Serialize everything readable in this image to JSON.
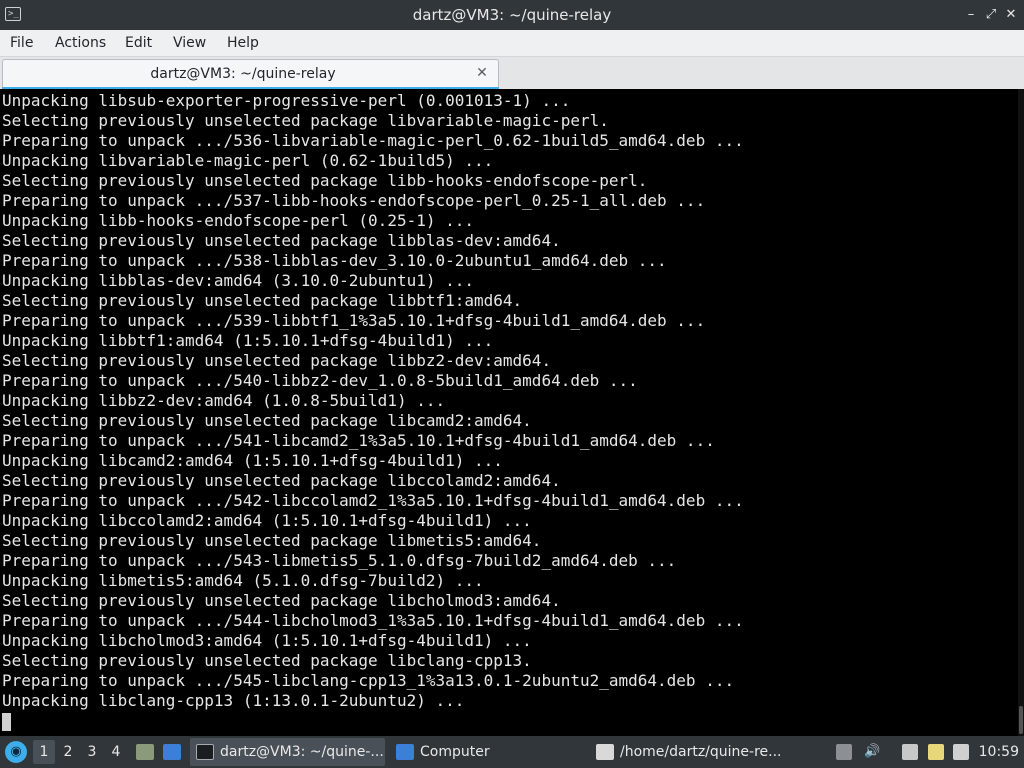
{
  "window": {
    "title": "dartz@VM3: ~/quine-relay",
    "app_icon_glyph": ">_",
    "min_glyph": "–",
    "max_glyph": "⤢",
    "close_glyph": "✕"
  },
  "menu": {
    "file": "File",
    "actions": "Actions",
    "edit": "Edit",
    "view": "View",
    "help": "Help"
  },
  "tab": {
    "label": "dartz@VM3: ~/quine-relay",
    "close_glyph": "✕",
    "accent_color": "#3daee9"
  },
  "terminal": {
    "background": "#000000",
    "foreground": "#e6e6e6",
    "lines": [
      "Unpacking libsub-exporter-progressive-perl (0.001013-1) ...",
      "Selecting previously unselected package libvariable-magic-perl.",
      "Preparing to unpack .../536-libvariable-magic-perl_0.62-1build5_amd64.deb ...",
      "Unpacking libvariable-magic-perl (0.62-1build5) ...",
      "Selecting previously unselected package libb-hooks-endofscope-perl.",
      "Preparing to unpack .../537-libb-hooks-endofscope-perl_0.25-1_all.deb ...",
      "Unpacking libb-hooks-endofscope-perl (0.25-1) ...",
      "Selecting previously unselected package libblas-dev:amd64.",
      "Preparing to unpack .../538-libblas-dev_3.10.0-2ubuntu1_amd64.deb ...",
      "Unpacking libblas-dev:amd64 (3.10.0-2ubuntu1) ...",
      "Selecting previously unselected package libbtf1:amd64.",
      "Preparing to unpack .../539-libbtf1_1%3a5.10.1+dfsg-4build1_amd64.deb ...",
      "Unpacking libbtf1:amd64 (1:5.10.1+dfsg-4build1) ...",
      "Selecting previously unselected package libbz2-dev:amd64.",
      "Preparing to unpack .../540-libbz2-dev_1.0.8-5build1_amd64.deb ...",
      "Unpacking libbz2-dev:amd64 (1.0.8-5build1) ...",
      "Selecting previously unselected package libcamd2:amd64.",
      "Preparing to unpack .../541-libcamd2_1%3a5.10.1+dfsg-4build1_amd64.deb ...",
      "Unpacking libcamd2:amd64 (1:5.10.1+dfsg-4build1) ...",
      "Selecting previously unselected package libccolamd2:amd64.",
      "Preparing to unpack .../542-libccolamd2_1%3a5.10.1+dfsg-4build1_amd64.deb ...",
      "Unpacking libccolamd2:amd64 (1:5.10.1+dfsg-4build1) ...",
      "Selecting previously unselected package libmetis5:amd64.",
      "Preparing to unpack .../543-libmetis5_5.1.0.dfsg-7build2_amd64.deb ...",
      "Unpacking libmetis5:amd64 (5.1.0.dfsg-7build2) ...",
      "Selecting previously unselected package libcholmod3:amd64.",
      "Preparing to unpack .../544-libcholmod3_1%3a5.10.1+dfsg-4build1_amd64.deb ...",
      "Unpacking libcholmod3:amd64 (1:5.10.1+dfsg-4build1) ...",
      "Selecting previously unselected package libclang-cpp13.",
      "Preparing to unpack .../545-libclang-cpp13_1%3a13.0.1-2ubuntu2_amd64.deb ...",
      "Unpacking libclang-cpp13 (1:13.0.1-2ubuntu2) ..."
    ]
  },
  "taskbar": {
    "start_icon": "start-menu-icon",
    "workspaces": [
      "1",
      "2",
      "3",
      "4"
    ],
    "active_workspace": "1",
    "tasks": {
      "terminal": "dartz@VM3: ~/quine-...",
      "computer": "Computer",
      "editor": "/home/dartz/quine-re..."
    },
    "clock": "10:59"
  }
}
